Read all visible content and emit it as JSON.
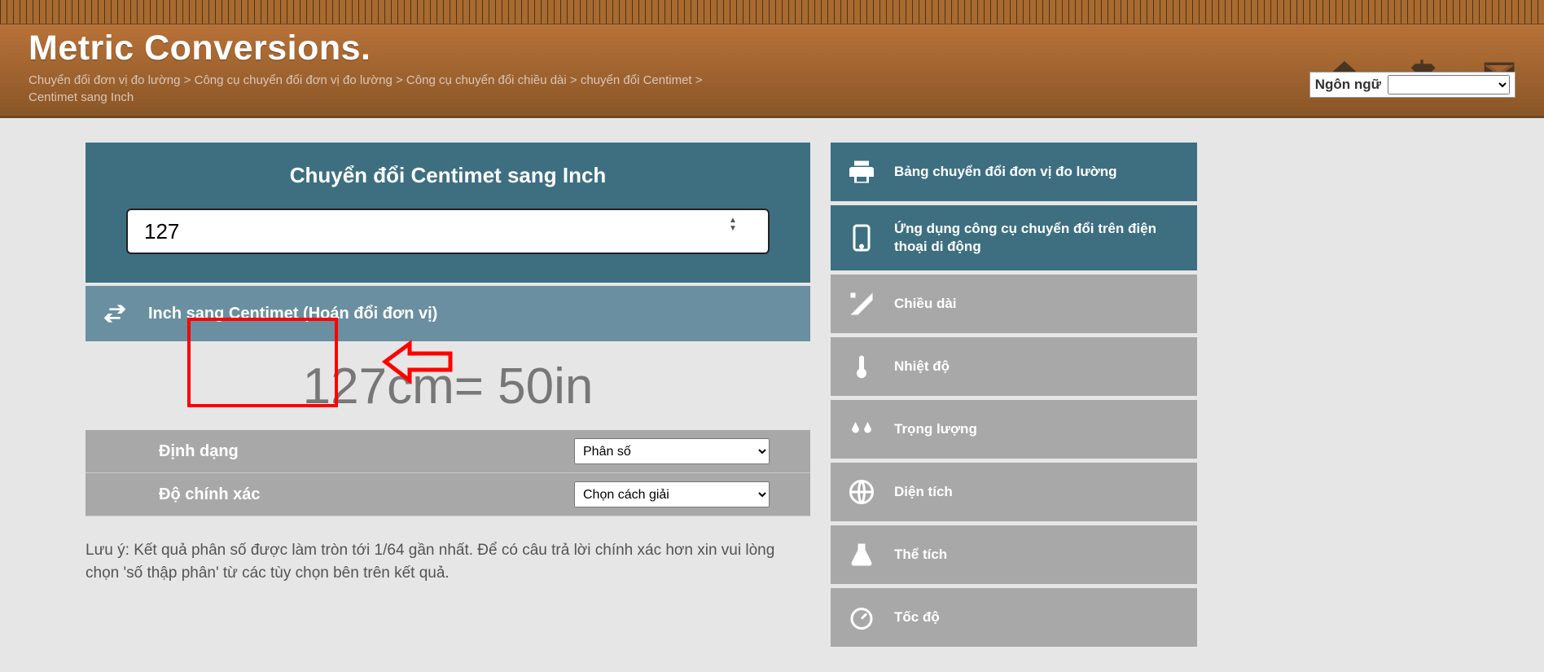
{
  "brand": "Metric Conversions.",
  "breadcrumb": {
    "p1": "Chuyển đổi đơn vị đo lường",
    "p2": "Công cụ chuyển đổi đơn vị đo lường",
    "p3": "Công cụ chuyển đổi chiều dài",
    "p4": "chuyển đổi Centimet",
    "p5": "Centimet sang Inch"
  },
  "lang_label": "Ngôn ngữ",
  "converter": {
    "title": "Chuyển đổi Centimet sang Inch",
    "input_value": "127",
    "swap_label": "Inch sang Centimet (Hoán đổi đơn vị)",
    "result": "127cm= 50in",
    "format_label": "Định dạng",
    "format_value": "Phân số",
    "precision_label": "Độ chính xác",
    "precision_value": "Chọn cách giải"
  },
  "note": "Lưu ý: Kết quả phân số được làm tròn tới 1/64 gần nhất. Để có câu trả lời chính xác hơn xin vui lòng chọn 'số thập phân' từ các tùy chọn bên trên kết quả.",
  "sidebar": {
    "items": [
      {
        "label": "Bảng chuyển đổi đơn vị đo lường"
      },
      {
        "label": "Ứng dụng công cụ chuyển đổi trên điện thoại di động"
      },
      {
        "label": "Chiều dài"
      },
      {
        "label": "Nhiệt độ"
      },
      {
        "label": "Trọng lượng"
      },
      {
        "label": "Diện tích"
      },
      {
        "label": "Thể tích"
      },
      {
        "label": "Tốc độ"
      }
    ]
  }
}
